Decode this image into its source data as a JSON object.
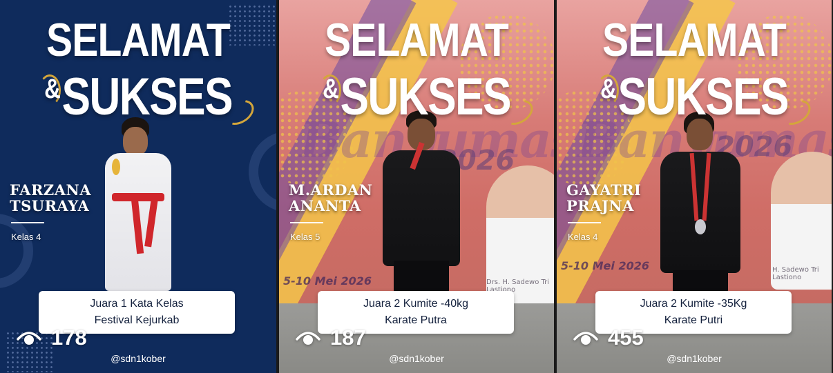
{
  "cards": [
    {
      "headline_line1": "SELAMAT",
      "headline_amp": "&",
      "headline_line2": "SUKSES",
      "name_line1": "FARZANA",
      "name_line2": "TSURAYA",
      "kelas": "Kelas 4",
      "award_line1": "Juara 1 Kata Kelas",
      "award_line2": "Festival Kejurkab",
      "views": "178",
      "handle": "@sdn1kober",
      "eye_icon": "eye-icon"
    },
    {
      "headline_line1": "SELAMAT",
      "headline_amp": "&",
      "headline_line2": "SUKSES",
      "name_line1": "M.ARDAN",
      "name_line2": "ANANTA",
      "kelas": "Kelas 5",
      "award_line1": "Juara 2 Kumite -40kg",
      "award_line2": "Karate Putra",
      "views": "187",
      "handle": "@sdn1kober",
      "eye_icon": "eye-icon",
      "bg_year": "2026",
      "bg_date": "5-10 Mei 2026",
      "bg_small": "Drs. H. Sadewo Tri Lastiono"
    },
    {
      "headline_line1": "SELAMAT",
      "headline_amp": "&",
      "headline_line2": "SUKSES",
      "name_line1": "GAYATRI",
      "name_line2": "PRAJNA",
      "kelas": "Kelas 4",
      "award_line1": "Juara 2 Kumite -35Kg",
      "award_line2": "Karate Putri",
      "views": "455",
      "handle": "@sdn1kober",
      "eye_icon": "eye-icon",
      "bg_year": "2026",
      "bg_date": "5-10 Mei 2026",
      "bg_small": "H. Sadewo Tri Lastiono"
    }
  ],
  "colors": {
    "navy": "#0f2b5c",
    "award_text": "#14213d",
    "banner_red": "#cf6d66",
    "gold": "#d4a63b"
  }
}
